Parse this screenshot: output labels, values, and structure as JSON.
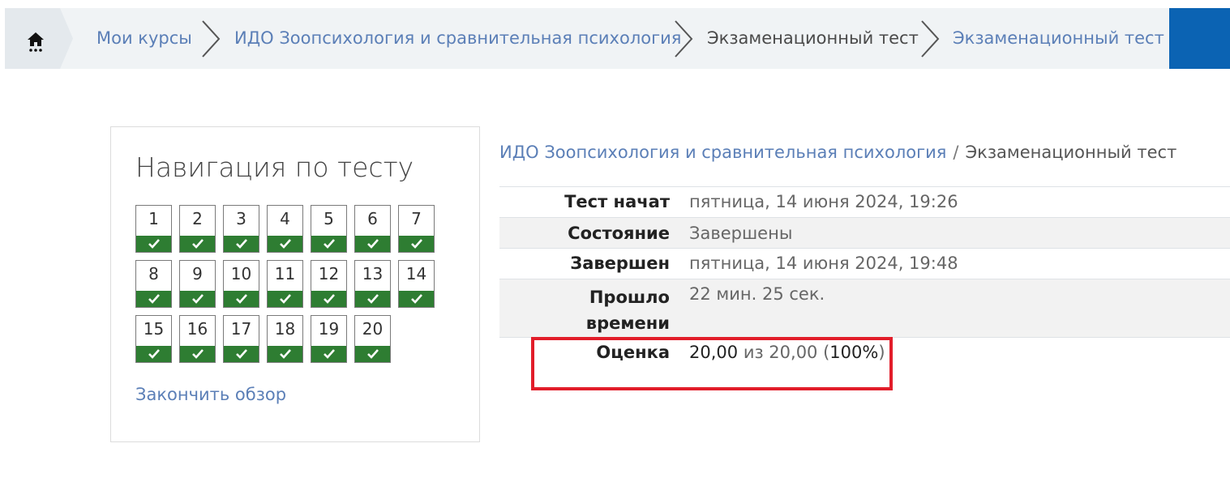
{
  "breadcrumb": {
    "home_icon": "home-icon",
    "items": [
      {
        "label": "Мои курсы",
        "link": true
      },
      {
        "label": "ИДО Зоопсихология и сравнительная психология",
        "link": true
      },
      {
        "label": "Экзаменационный тест",
        "link": false
      },
      {
        "label": "Экзаменационный тест",
        "link": true
      }
    ],
    "separator_icon": "chevron-right-icon",
    "accent_color": "#0b63b3"
  },
  "quiz_nav": {
    "title": "Навигация по тесту",
    "questions": [
      "1",
      "2",
      "3",
      "4",
      "5",
      "6",
      "7",
      "8",
      "9",
      "10",
      "11",
      "12",
      "13",
      "14",
      "15",
      "16",
      "17",
      "18",
      "19",
      "20"
    ],
    "status_icon": "check-icon",
    "status_color": "#2e7d32",
    "finish_label": "Закончить обзор"
  },
  "summary": {
    "course": "ИДО Зоопсихология и сравнительная психология",
    "sep": "/",
    "test": "Экзаменационный тест",
    "rows": [
      {
        "label": "Тест начат",
        "value": "пятница, 14 июня 2024, 19:26"
      },
      {
        "label": "Состояние",
        "value": "Завершены"
      },
      {
        "label": "Завершен",
        "value": "пятница, 14 июня 2024, 19:48"
      },
      {
        "label_line1": "Прошло",
        "label_line2": "времени",
        "value": "22 мин. 25 сек."
      },
      {
        "label": "Оценка",
        "grade": "20,00",
        "of_text": "из 20,00 (",
        "percent": "100%",
        "close": ")"
      }
    ],
    "highlight_color": "#e21d2a"
  }
}
